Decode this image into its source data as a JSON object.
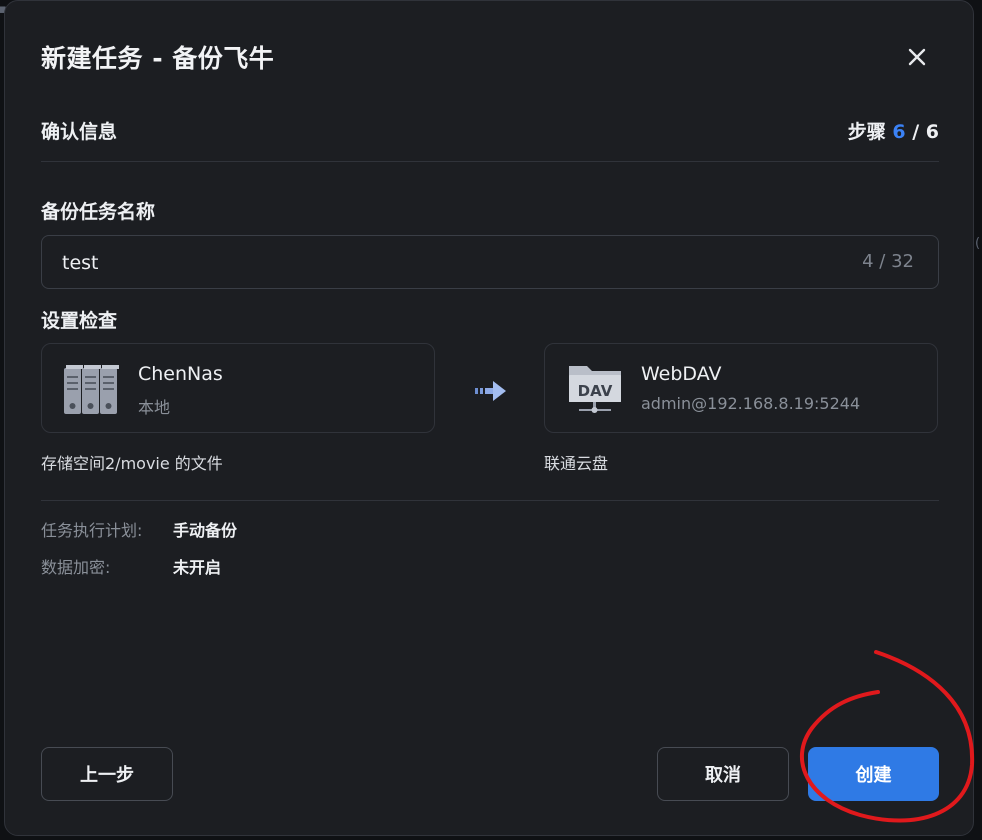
{
  "dialog": {
    "title": "新建任务 - 备份飞牛",
    "section_title": "确认信息",
    "step_label": "步骤",
    "step_current": "6",
    "step_separator": " / ",
    "step_total": "6"
  },
  "task_name": {
    "label": "备份任务名称",
    "value": "test",
    "counter": "4 / 32"
  },
  "settings_check": {
    "label": "设置检查",
    "source": {
      "name": "ChenNas",
      "sub": "本地",
      "icon": "server-rack-icon",
      "caption": "存储空间2/movie 的文件"
    },
    "destination": {
      "name": "WebDAV",
      "sub": "admin@192.168.8.19:5244",
      "icon": "dav-folder-icon",
      "icon_text": "DAV",
      "caption": "联通云盘"
    }
  },
  "details": [
    {
      "key": "任务执行计划:",
      "value": "手动备份"
    },
    {
      "key": "数据加密:",
      "value": "未开启"
    }
  ],
  "buttons": {
    "prev": "上一步",
    "cancel": "取消",
    "create": "创建"
  },
  "colors": {
    "accent": "#2f7ae5",
    "step_highlight": "#3b82f6",
    "annotation": "#e0191c"
  }
}
